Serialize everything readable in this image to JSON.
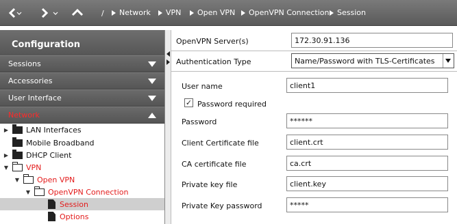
{
  "toolbar": {
    "back_icon": "chevron-left-icon",
    "forward_icon": "chevron-right-icon",
    "up_icon": "chevron-up-icon",
    "separator": "/"
  },
  "breadcrumb": [
    "Network",
    "VPN",
    "Open VPN",
    "OpenVPN Connection",
    "Session"
  ],
  "sidebar": {
    "title": "Configuration",
    "sections": [
      {
        "label": "Sessions"
      },
      {
        "label": "Accessories"
      },
      {
        "label": "User Interface"
      },
      {
        "label": "Network"
      }
    ],
    "tree": [
      {
        "label": "LAN Interfaces"
      },
      {
        "label": "Mobile Broadband"
      },
      {
        "label": "DHCP Client"
      },
      {
        "label": "VPN"
      },
      {
        "label": "Open VPN"
      },
      {
        "label": "OpenVPN Connection"
      },
      {
        "label": "Session"
      },
      {
        "label": "Options"
      }
    ]
  },
  "form": {
    "server_label": "OpenVPN Server(s)",
    "server_value": "172.30.91.136",
    "auth_label": "Authentication Type",
    "auth_value": "Name/Password with TLS-Certificates",
    "username_label": "User name",
    "username_value": "client1",
    "password_required_label": "Password required",
    "password_required_checked": true,
    "password_label": "Password",
    "password_value": "******",
    "client_cert_label": "Client Certificate file",
    "client_cert_value": "client.crt",
    "ca_cert_label": "CA certificate file",
    "ca_cert_value": "ca.crt",
    "private_key_label": "Private key file",
    "private_key_value": "client.key",
    "private_key_password_label": "Private Key password",
    "private_key_password_value": "*****"
  },
  "colors": {
    "active_red": "#e31b1b",
    "toolbar_gray": "#6a6a6a"
  }
}
